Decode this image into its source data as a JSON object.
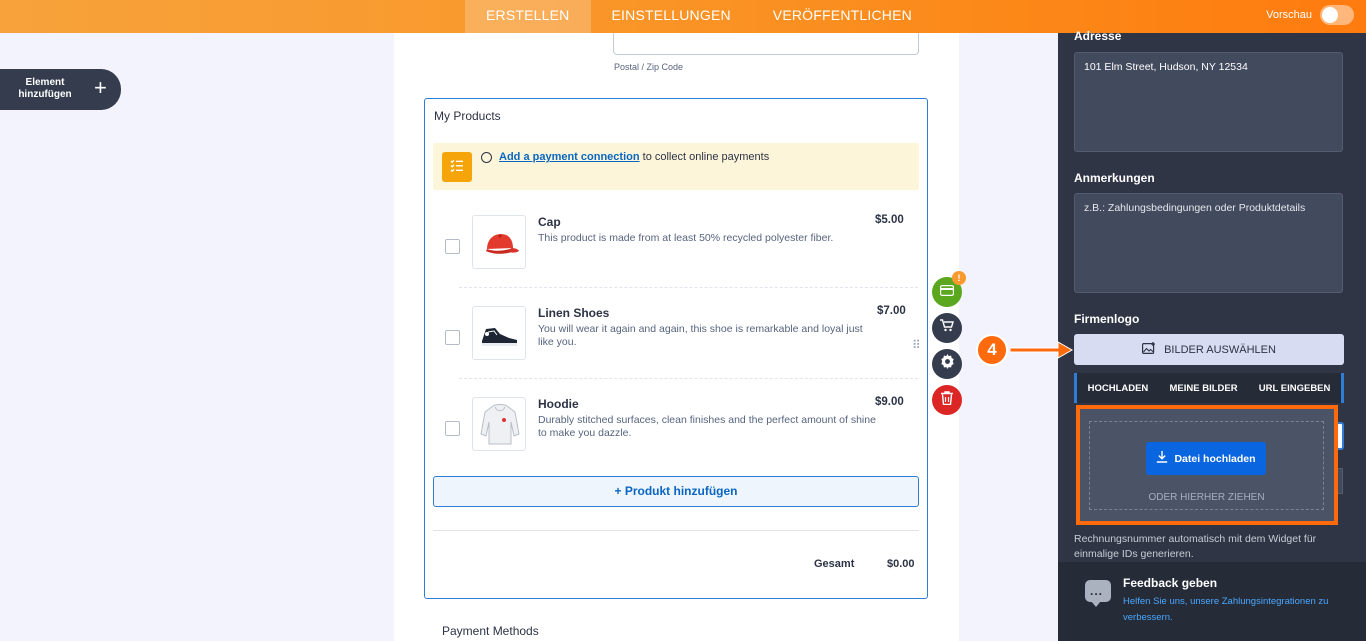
{
  "topbar": {
    "tabs": [
      {
        "label": "ERSTELLEN",
        "active": true
      },
      {
        "label": "EINSTELLUNGEN",
        "active": false
      },
      {
        "label": "VERÖFFENTLICHEN",
        "active": false
      }
    ],
    "preview_label": "Vorschau"
  },
  "left": {
    "add_element_label": "Element hinzufügen",
    "plus_icon": "+"
  },
  "form": {
    "zip_label": "Postal / Zip Code",
    "products": {
      "title": "My Products",
      "notice_link": "Add a payment connection",
      "notice_rest": " to collect online payments",
      "items": [
        {
          "name": "Cap",
          "description": "This product is made from at least 50% recycled polyester fiber.",
          "price": "$5.00"
        },
        {
          "name": "Linen Shoes",
          "description": "You will wear it again and again, this shoe is remarkable and loyal just like you.",
          "price": "$7.00"
        },
        {
          "name": "Hoodie",
          "description": "Durably stitched surfaces, clean finishes and the perfect amount of shine to make you dazzle.",
          "price": "$9.00"
        }
      ],
      "add_product_label": "+ Produkt hinzufügen",
      "total_label": "Gesamt",
      "total_value": "$0.00"
    },
    "payment_methods_label": "Payment Methods"
  },
  "tools": {
    "badge": "!"
  },
  "panel": {
    "address_label": "Adresse",
    "address_value": "101 Elm Street, Hudson, NY 12534",
    "notes_label": "Anmerkungen",
    "notes_placeholder": "z.B.: Zahlungsbedingungen oder Produktdetails",
    "logo_label": "Firmenlogo",
    "select_images_label": "BILDER AUSWÄHLEN",
    "upload_tabs": [
      "HOCHLADEN",
      "MEINE BILDER",
      "URL EINGEBEN"
    ],
    "upload_button_label": "Datei hochladen",
    "drag_label": "ODER HIERHER ZIEHEN",
    "help_text": "Rechnungsnummer automatisch mit dem Widget für einmalige IDs generieren.",
    "feedback_title": "Feedback geben",
    "feedback_link": "Helfen Sie uns, unsere Zahlungsintegrationen zu verbessern."
  },
  "annotation": {
    "step_number": "4"
  },
  "colors": {
    "accent_orange": "#ff7b0f",
    "panel_bg": "#2f3545",
    "primary_blue": "#0a66e0"
  }
}
